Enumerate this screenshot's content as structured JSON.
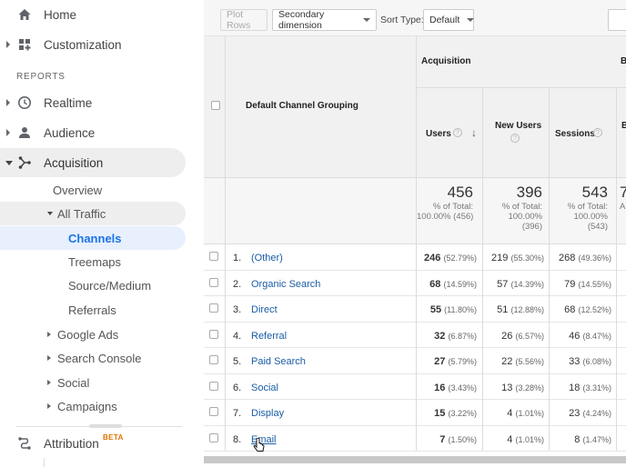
{
  "sidebar": {
    "home": "Home",
    "customization": "Customization",
    "reports_header": "REPORTS",
    "realtime": "Realtime",
    "audience": "Audience",
    "acquisition": "Acquisition",
    "overview": "Overview",
    "all_traffic": "All Traffic",
    "channels": "Channels",
    "treemaps": "Treemaps",
    "source_medium": "Source/Medium",
    "referrals": "Referrals",
    "google_ads": "Google Ads",
    "search_console": "Search Console",
    "social": "Social",
    "campaigns": "Campaigns",
    "attribution": "Attribution",
    "beta": "BETA"
  },
  "toolbar": {
    "plot_rows": "Plot Rows",
    "secondary_dimension": "Secondary dimension",
    "sort_type_label": "Sort Type:",
    "sort_type_value": "Default"
  },
  "table": {
    "dimension_header": "Default Channel Grouping",
    "group_header": "Acquisition",
    "col_users": "Users",
    "col_new_users": "New Users",
    "col_sessions": "Sessions",
    "col_next_initial": "B",
    "help_glyph": "?",
    "sort_glyph": "↓",
    "totals": {
      "users": "456",
      "users_sub1": "% of Total:",
      "users_sub2": "100.00% (456)",
      "new_users": "396",
      "new_users_sub1": "% of Total:",
      "new_users_sub2": "100.00%",
      "new_users_sub3": "(396)",
      "sessions": "543",
      "sessions_sub1": "% of Total:",
      "sessions_sub2": "100.00%",
      "sessions_sub3": "(543)",
      "partial": "7",
      "partial_sub": "A"
    },
    "rows": [
      {
        "n": "1.",
        "name": "(Other)",
        "users": "246",
        "users_pct": "(52.79%)",
        "new_users": "219",
        "new_users_pct": "(55.30%)",
        "sessions": "268",
        "sessions_pct": "(49.36%)"
      },
      {
        "n": "2.",
        "name": "Organic Search",
        "users": "68",
        "users_pct": "(14.59%)",
        "new_users": "57",
        "new_users_pct": "(14.39%)",
        "sessions": "79",
        "sessions_pct": "(14.55%)"
      },
      {
        "n": "3.",
        "name": "Direct",
        "users": "55",
        "users_pct": "(11.80%)",
        "new_users": "51",
        "new_users_pct": "(12.88%)",
        "sessions": "68",
        "sessions_pct": "(12.52%)"
      },
      {
        "n": "4.",
        "name": "Referral",
        "users": "32",
        "users_pct": "(6.87%)",
        "new_users": "26",
        "new_users_pct": "(6.57%)",
        "sessions": "46",
        "sessions_pct": "(8.47%)"
      },
      {
        "n": "5.",
        "name": "Paid Search",
        "users": "27",
        "users_pct": "(5.79%)",
        "new_users": "22",
        "new_users_pct": "(5.56%)",
        "sessions": "33",
        "sessions_pct": "(6.08%)"
      },
      {
        "n": "6.",
        "name": "Social",
        "users": "16",
        "users_pct": "(3.43%)",
        "new_users": "13",
        "new_users_pct": "(3.28%)",
        "sessions": "18",
        "sessions_pct": "(3.31%)"
      },
      {
        "n": "7.",
        "name": "Display",
        "users": "15",
        "users_pct": "(3.22%)",
        "new_users": "4",
        "new_users_pct": "(1.01%)",
        "sessions": "23",
        "sessions_pct": "(4.24%)"
      },
      {
        "n": "8.",
        "name": "Email",
        "users": "7",
        "users_pct": "(1.50%)",
        "new_users": "4",
        "new_users_pct": "(1.01%)",
        "sessions": "8",
        "sessions_pct": "(1.47%)"
      }
    ]
  },
  "colors": {
    "accent": "#1a73e8",
    "link": "#1a5da6",
    "active_bg": "#e8f0fe",
    "beta": "#e37400"
  },
  "icons": [
    "home-icon",
    "customization-icon",
    "clock-icon",
    "person-icon",
    "acquisition-icon",
    "attribution-icon",
    "help-icon",
    "sort-down-icon",
    "mouse-pointer-icon"
  ]
}
